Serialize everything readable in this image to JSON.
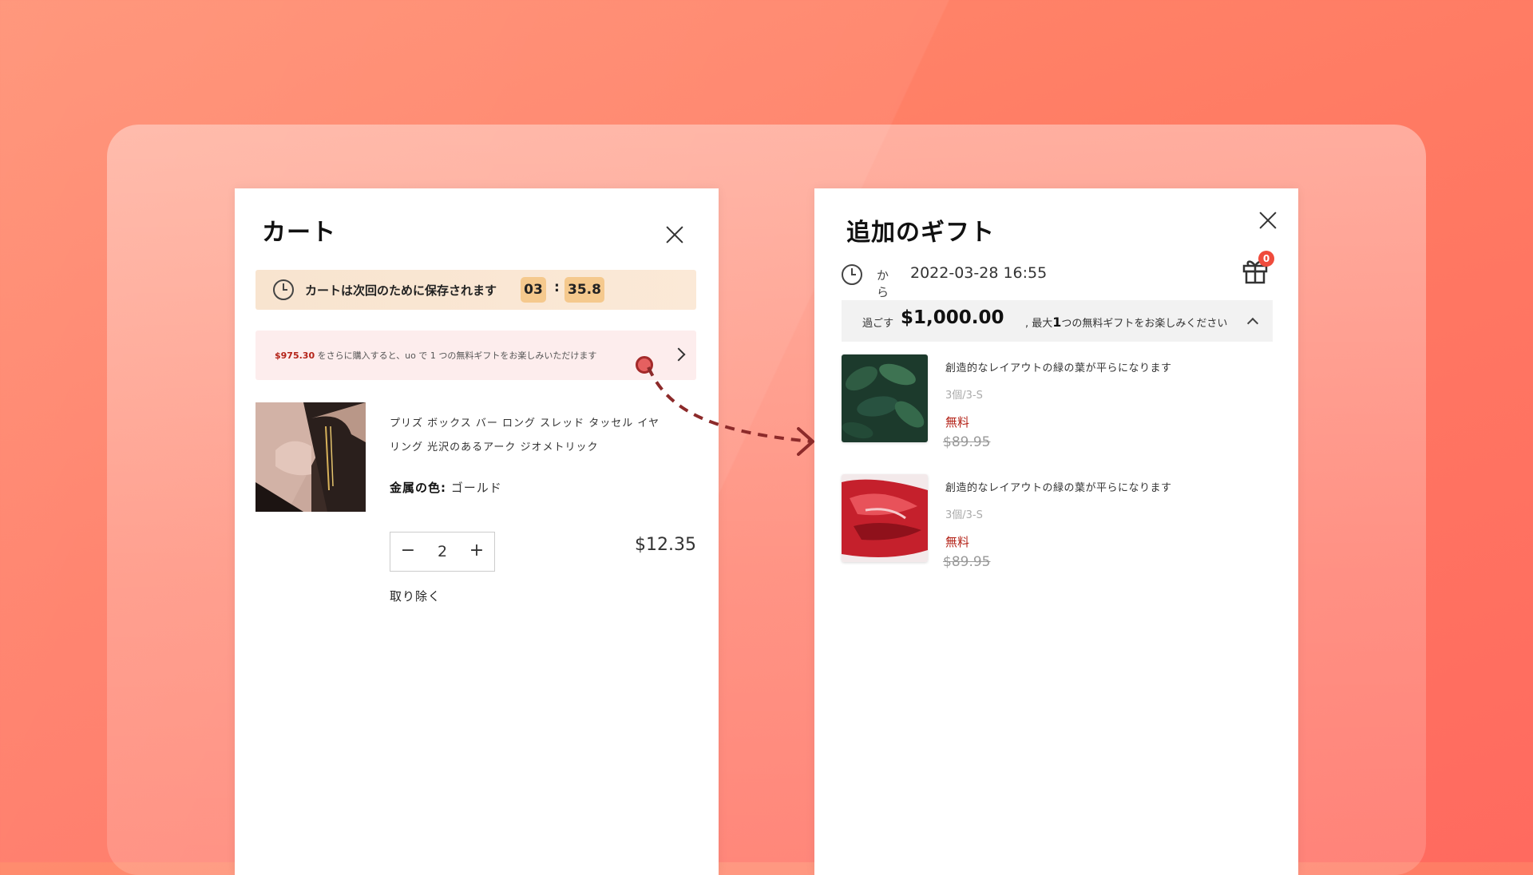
{
  "cart": {
    "title": "カート",
    "timer": {
      "text": "カートは次回のために保存されます",
      "minutes": "03",
      "separator": ":",
      "seconds": "35.8"
    },
    "promo": {
      "amount": "$975.30",
      "text": " をさらに購入すると、uo で 1 つの無料ギフトをお楽しみいただけます"
    },
    "item": {
      "name": "プリズ ボックス バー ロング スレッド タッセル イヤリング 光沢のあるアーク ジオメトリック",
      "attr_label": "金属の色:",
      "attr_value": " ゴールド",
      "quantity": "2",
      "minus": "−",
      "plus": "+",
      "price": "$12.35",
      "remove": "取り除く"
    }
  },
  "gifts": {
    "title": "追加のギフト",
    "from_label": "から",
    "date": "2022-03-28 16:55",
    "badge_count": "0",
    "spend": {
      "label": "過ごす",
      "amount": "$1,000.00",
      "comma": ",",
      "rest_prefix": " 最大",
      "max": "1",
      "rest_suffix": "つの無料ギフトをお楽しみください"
    },
    "items": [
      {
        "title": "創造的なレイアウトの緑の葉が平らになります",
        "variant": "3個/3-S",
        "price": "無料",
        "original_price": "$89.95"
      },
      {
        "title": "創造的なレイアウトの緑の葉が平らになります",
        "variant": "3個/3-S",
        "price": "無料",
        "original_price": "$89.95"
      }
    ]
  },
  "icons": [
    "close-icon",
    "clock-icon",
    "chevron-right-icon",
    "gift-icon",
    "chevron-up-icon"
  ],
  "colors": {
    "accent_red": "#b42318",
    "badge_red": "#ef4b3c",
    "timer_bg": "#f8e4cf",
    "timer_chip": "#f5c98d",
    "promo_bg": "#fdeded"
  }
}
